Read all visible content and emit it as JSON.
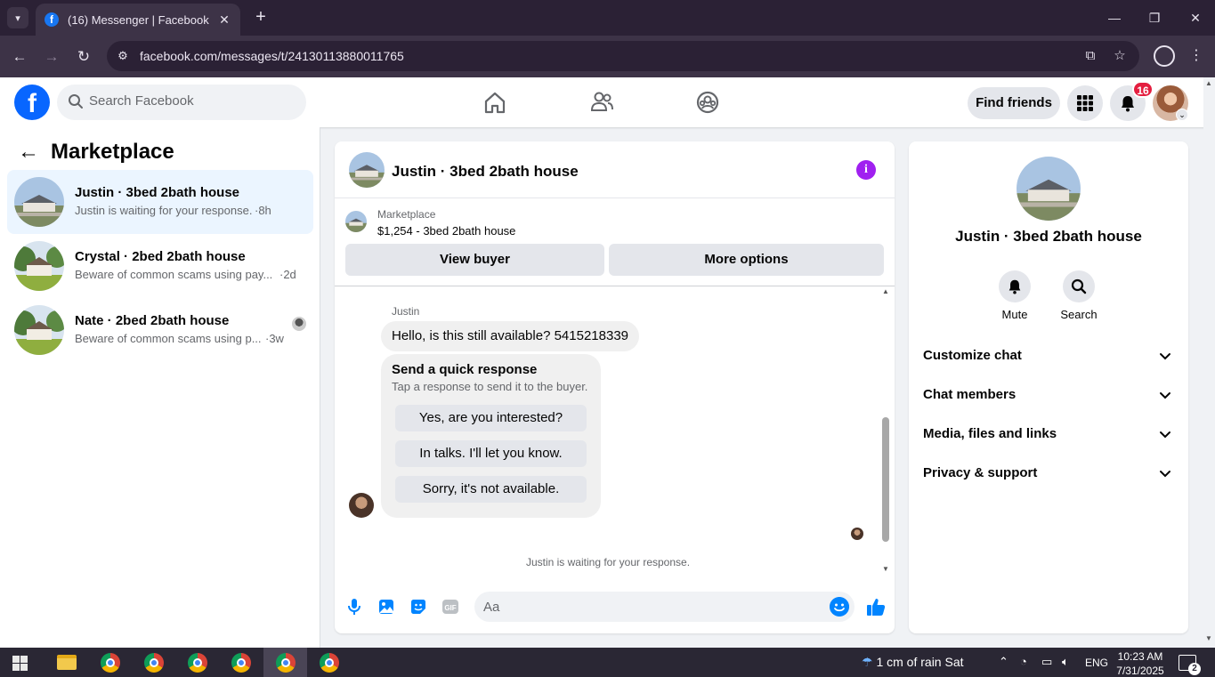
{
  "browser": {
    "tab_title": "(16) Messenger | Facebook",
    "url": "facebook.com/messages/t/24130113880011765"
  },
  "header": {
    "search_placeholder": "Search Facebook",
    "find_friends_label": "Find friends",
    "notification_count": "16"
  },
  "sidebar": {
    "title": "Marketplace",
    "conversations": [
      {
        "title": "Justin · 3bed 2bath house",
        "preview": "Justin is waiting for your response.",
        "time": "·8h",
        "active": true
      },
      {
        "title": "Crystal · 2bed 2bath house",
        "preview": "Beware of common scams using pay...",
        "time": "·2d",
        "active": false
      },
      {
        "title": "Nate · 2bed 2bath house",
        "preview": "Beware of common scams using p...",
        "time": "·3w",
        "active": false
      }
    ]
  },
  "chat": {
    "title": "Justin · 3bed 2bath house",
    "listing_label": "Marketplace",
    "listing_price_title": "$1,254 - 3bed 2bath house",
    "view_buyer_label": "View buyer",
    "more_options_label": "More options",
    "sender_name": "Justin",
    "message": "Hello, is this still available? 5415218339",
    "quick_response": {
      "title": "Send a quick response",
      "subtitle": "Tap a response to send it to the buyer.",
      "options": [
        "Yes, are you interested?",
        "In talks. I'll let you know.",
        "Sorry, it's not available."
      ]
    },
    "waiting_text": "Justin is waiting for your response.",
    "composer_placeholder": "Aa"
  },
  "details": {
    "title": "Justin · 3bed 2bath house",
    "actions": [
      "Mute",
      "Search"
    ],
    "sections": [
      "Customize chat",
      "Chat members",
      "Media, files and links",
      "Privacy & support"
    ]
  },
  "taskbar": {
    "weather": "1 cm of rain Sat",
    "language": "ENG",
    "time": "10:23 AM",
    "date": "7/31/2025",
    "notification_count": "2"
  },
  "colors": {
    "facebook_blue": "#0866ff",
    "messenger_blue": "#0084ff",
    "info_purple": "#a020f0",
    "badge_red": "#e41e3f",
    "active_row": "#ebf5ff"
  }
}
